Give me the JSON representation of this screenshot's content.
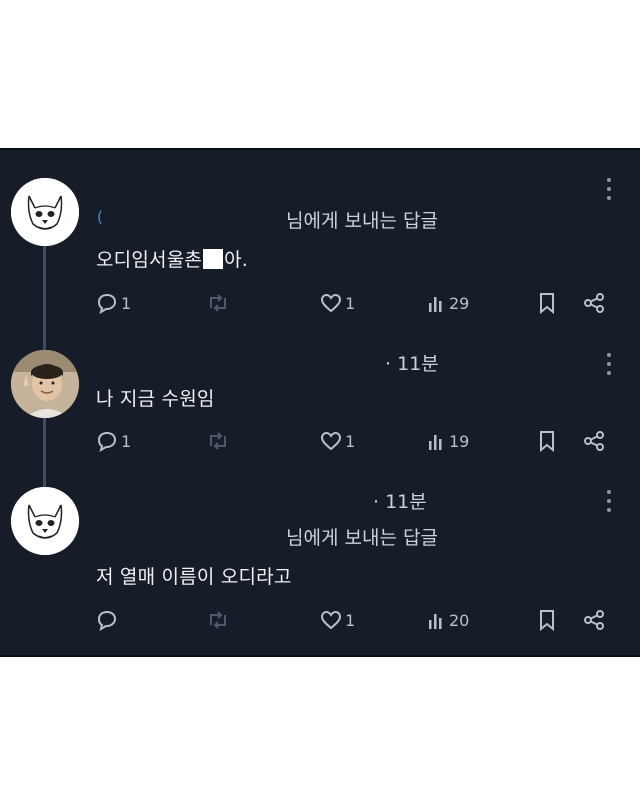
{
  "tweets": [
    {
      "reply_to": "님에게 보내는 답글",
      "body_before": "오디임서울촌",
      "body_after": "아.",
      "actions": {
        "replies": "1",
        "likes": "1",
        "views": "29"
      }
    },
    {
      "time": "· 11분",
      "body": "나 지금 수원임",
      "actions": {
        "replies": "1",
        "likes": "1",
        "views": "19"
      }
    },
    {
      "time": "· 11분",
      "reply_to": "님에게 보내는 답글",
      "body": "저 열매 이름이 오디라고",
      "actions": {
        "likes": "1",
        "views": "20"
      }
    }
  ],
  "icons": {
    "reply": "speech-bubble-icon",
    "retweet": "retweet-arrows-icon",
    "like": "heart-outline-icon",
    "views": "bar-chart-icon",
    "bookmark": "bookmark-icon",
    "share": "share-nodes-icon",
    "more": "vertical-ellipsis-icon"
  },
  "colors": {
    "background": "#171d28",
    "text": "#eef1f4",
    "muted": "#b7c1cc",
    "thread_line": "#3e4d63",
    "accent": "#4a90d9"
  }
}
